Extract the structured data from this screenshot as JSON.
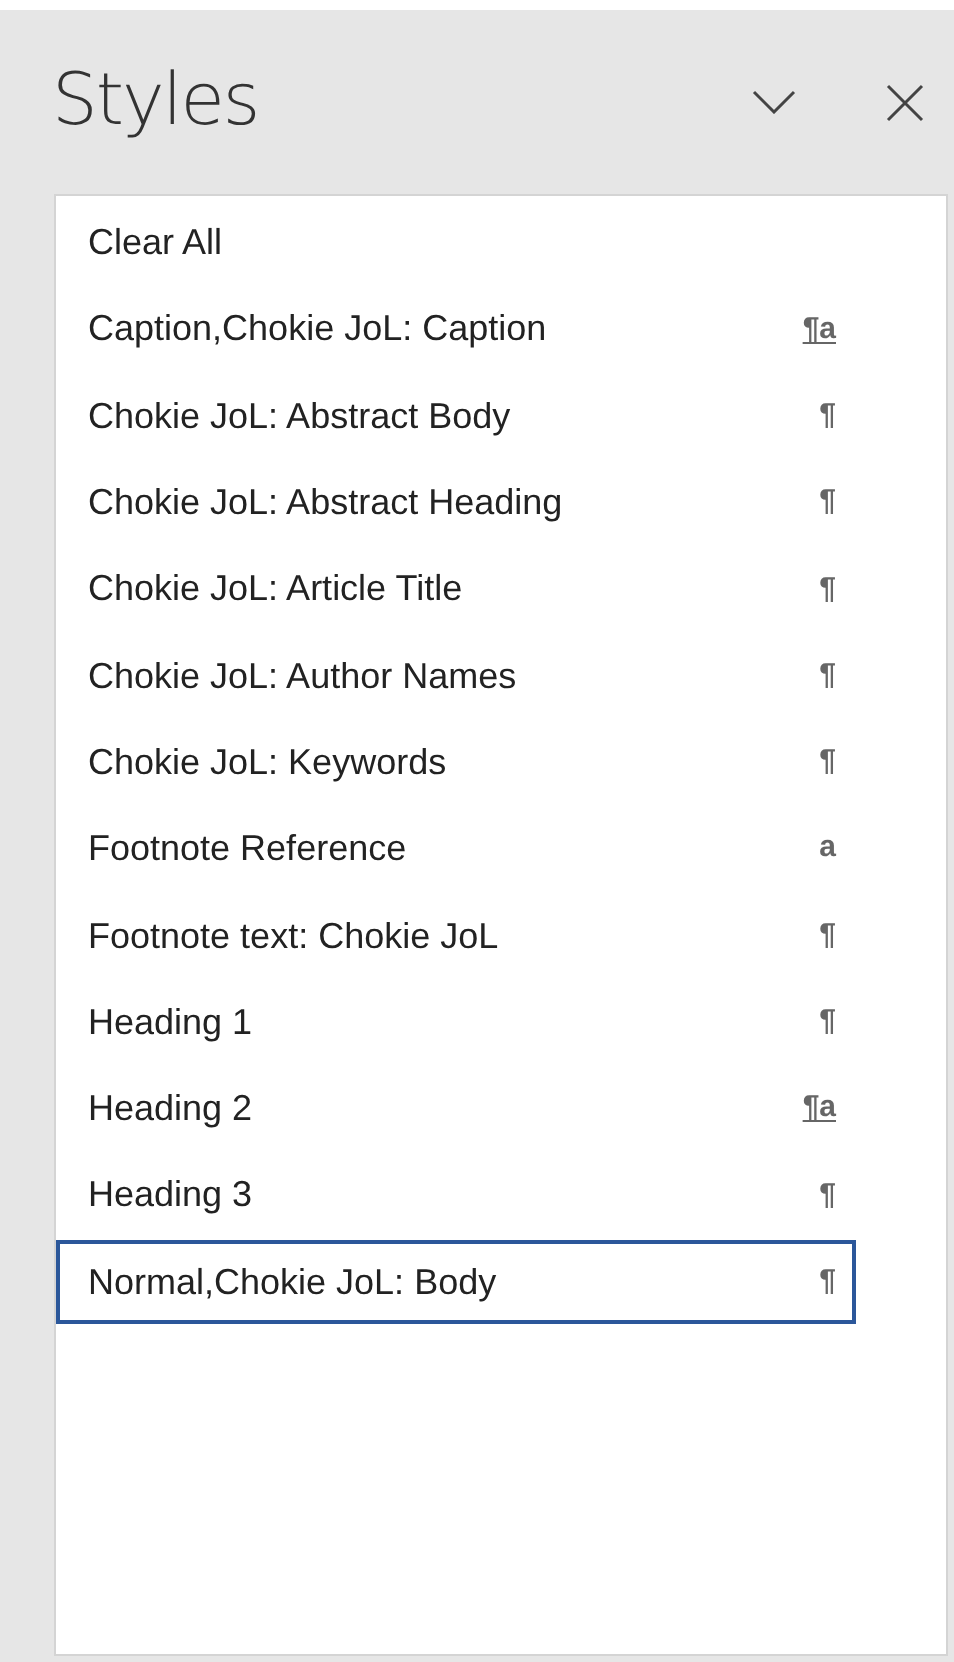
{
  "pane": {
    "title": "Styles"
  },
  "styles": [
    {
      "label": "Clear All",
      "selected": false
    },
    {
      "label": "Caption,Chokie JoL: Caption",
      "kind": "linked",
      "icon": "¶a",
      "selected": false
    },
    {
      "label": "Chokie JoL: Abstract Body",
      "kind": "paragraph",
      "icon": "¶",
      "selected": false
    },
    {
      "label": "Chokie JoL: Abstract Heading",
      "kind": "paragraph",
      "icon": "¶",
      "selected": false
    },
    {
      "label": "Chokie JoL: Article Title",
      "kind": "paragraph",
      "icon": "¶",
      "selected": false
    },
    {
      "label": "Chokie JoL: Author Names",
      "kind": "paragraph",
      "icon": "¶",
      "selected": false
    },
    {
      "label": "Chokie JoL: Keywords",
      "kind": "paragraph",
      "icon": "¶",
      "selected": false
    },
    {
      "label": "Footnote Reference",
      "kind": "character",
      "icon": "a",
      "selected": false
    },
    {
      "label": "Footnote text: Chokie JoL",
      "kind": "paragraph",
      "icon": "¶",
      "selected": false
    },
    {
      "label": "Heading 1",
      "kind": "paragraph",
      "icon": "¶",
      "selected": false
    },
    {
      "label": "Heading 2",
      "kind": "linked",
      "icon": "¶a",
      "selected": false
    },
    {
      "label": "Heading 3",
      "kind": "paragraph",
      "icon": "¶",
      "selected": false
    },
    {
      "label": "Normal,Chokie JoL: Body",
      "kind": "paragraph",
      "icon": "¶",
      "selected": true
    }
  ]
}
